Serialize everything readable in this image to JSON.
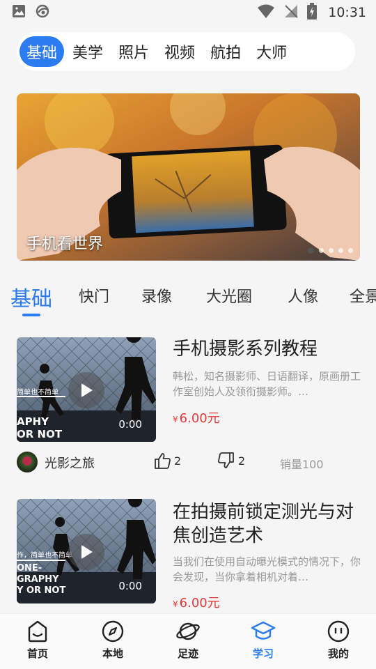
{
  "status_bar": {
    "time": "10:31"
  },
  "top_tabs": [
    "基础",
    "美学",
    "照片",
    "视频",
    "航拍",
    "大师"
  ],
  "top_tabs_active": "基础",
  "banner": {
    "caption": "手机看世界",
    "dots": 5,
    "active_dot": 1
  },
  "sub_tabs": [
    "基础",
    "快门",
    "录像",
    "大光圈",
    "人像",
    "全景"
  ],
  "sub_tabs_active": "基础",
  "courses": [
    {
      "title": "手机摄影系列教程",
      "description": "韩松，知名摄影师、日语翻译，原画册工作室创始人及领衔摄影师。…",
      "price_symbol": "¥",
      "price": "6.00元",
      "duration": "0:00",
      "thumb_text": [
        "简单也不简单",
        "APHY",
        "OR NOT"
      ],
      "author": "光影之旅",
      "likes": "2",
      "dislikes": "2",
      "sales": "销量100"
    },
    {
      "title": "在拍摄前锁定测光与对焦创造艺术",
      "description": "当我们在使用自动曝光模式的情况下，你会发现，当你拿着相机对着…",
      "price_symbol": "¥",
      "price": "6.00元",
      "duration": "0:00",
      "thumb_text": [
        "作，简单也不简单",
        "ONE-",
        "GRAPHY",
        "Y OR NOT"
      ]
    }
  ],
  "bottom_nav": [
    {
      "label": "首页",
      "icon": "home-face-icon"
    },
    {
      "label": "本地",
      "icon": "compass-icon"
    },
    {
      "label": "足迹",
      "icon": "planet-icon"
    },
    {
      "label": "学习",
      "icon": "graduation-cap-icon"
    },
    {
      "label": "我的",
      "icon": "smiley-icon"
    }
  ],
  "bottom_nav_active": "学习",
  "colors": {
    "accent": "#2b7cf0",
    "price": "#e23b3b"
  }
}
